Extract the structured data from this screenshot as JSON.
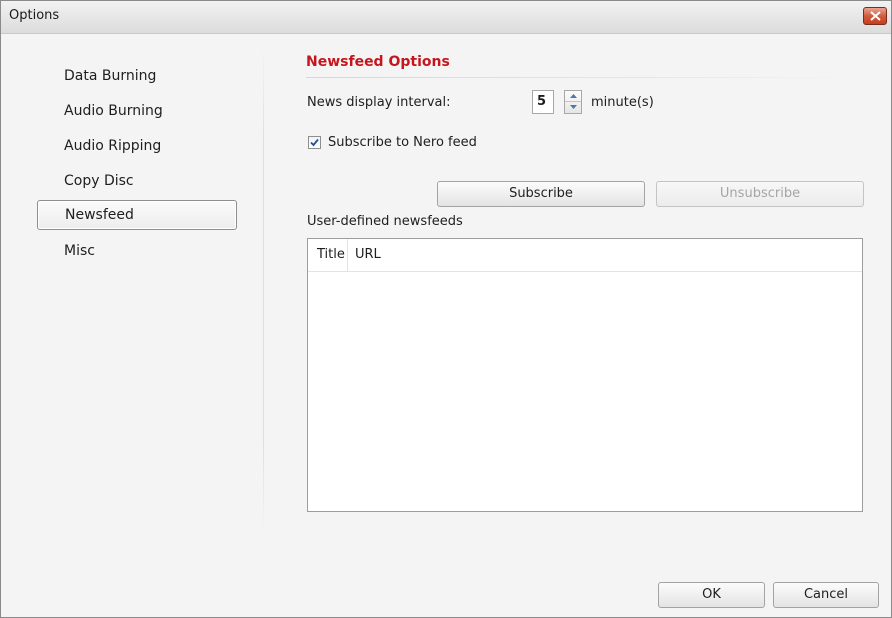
{
  "window": {
    "title": "Options"
  },
  "sidebar": {
    "items": [
      {
        "label": "Data Burning",
        "active": false
      },
      {
        "label": "Audio Burning",
        "active": false
      },
      {
        "label": "Audio Ripping",
        "active": false
      },
      {
        "label": "Copy Disc",
        "active": false
      },
      {
        "label": "Newsfeed",
        "active": true
      },
      {
        "label": "Misc",
        "active": false
      }
    ]
  },
  "newsfeed": {
    "section_title": "Newsfeed Options",
    "interval_label": "News display interval:",
    "interval_value": "5",
    "interval_unit": "minute(s)",
    "subscribe_checkbox_label": "Subscribe to Nero feed",
    "subscribe_checked": true,
    "subscribe_button": "Subscribe",
    "unsubscribe_button": "Unsubscribe",
    "user_feeds_label": "User-defined newsfeeds",
    "columns": [
      "Title",
      "URL"
    ],
    "rows": []
  },
  "footer": {
    "ok_button": "OK",
    "cancel_button": "Cancel"
  },
  "colors": {
    "section_title": "#c4161c",
    "close_button": "#d25c3e"
  },
  "icons": {
    "close": "close-icon",
    "checkmark": "checkmark-icon",
    "spin_up": "arrow-up-icon",
    "spin_down": "arrow-down-icon"
  }
}
